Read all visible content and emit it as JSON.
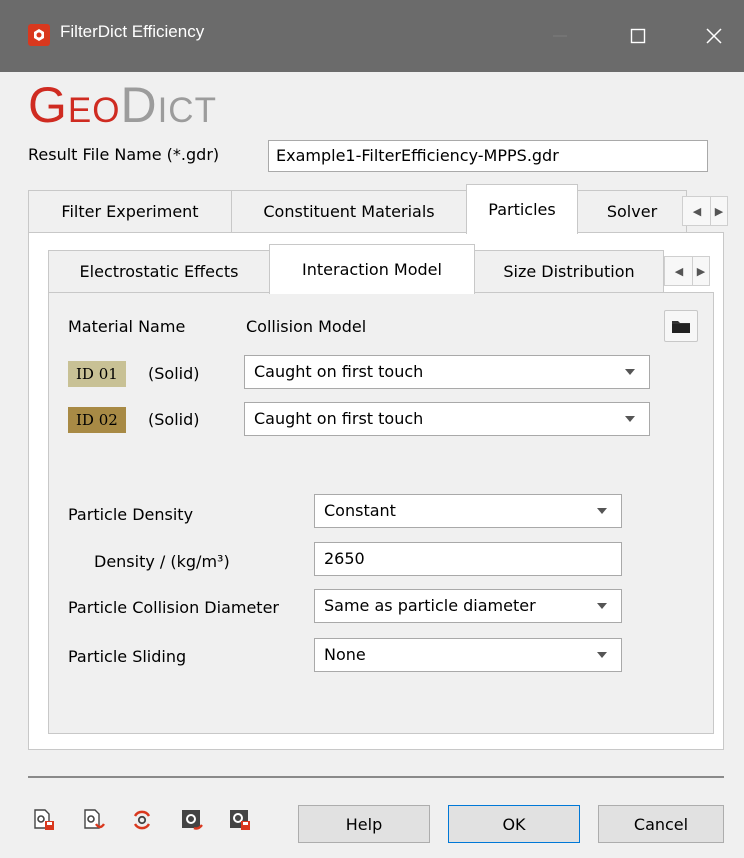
{
  "window": {
    "title": "FilterDict Efficiency"
  },
  "logo": {
    "part1": "Geo",
    "part2": "Dict",
    "brand_color": "#cf2b21"
  },
  "result_file": {
    "label": "Result File Name (*.gdr)",
    "value": "Example1-FilterEfficiency-MPPS.gdr"
  },
  "outer_tabs": [
    {
      "label": "Filter Experiment"
    },
    {
      "label": "Constituent Materials"
    },
    {
      "label": "Particles",
      "active": true
    },
    {
      "label": "Solver"
    }
  ],
  "inner_tabs": [
    {
      "label": "Electrostatic Effects"
    },
    {
      "label": "Interaction Model",
      "active": true
    },
    {
      "label": "Size Distribution"
    }
  ],
  "interaction": {
    "material_header": "Material Name",
    "collision_header": "Collision Model",
    "materials": [
      {
        "id": "ID 01",
        "type": "(Solid)",
        "collision": "Caught on first touch",
        "color": "#c8c195"
      },
      {
        "id": "ID 02",
        "type": "(Solid)",
        "collision": "Caught on first touch",
        "color": "#a88a45"
      }
    ]
  },
  "density": {
    "label": "Particle Density",
    "value": "Constant"
  },
  "density_value": {
    "label": "Density / (kg/m³)",
    "value": "2650"
  },
  "collision_diameter": {
    "label": "Particle Collision Diameter",
    "value": "Same as particle diameter"
  },
  "sliding": {
    "label": "Particle Sliding",
    "value": "None"
  },
  "buttons": {
    "help": "Help",
    "ok": "OK",
    "cancel": "Cancel"
  },
  "toolbar_icons": [
    "save-settings-icon",
    "load-settings-icon",
    "reset-settings-icon",
    "edit-macro-icon",
    "export-macro-icon"
  ]
}
